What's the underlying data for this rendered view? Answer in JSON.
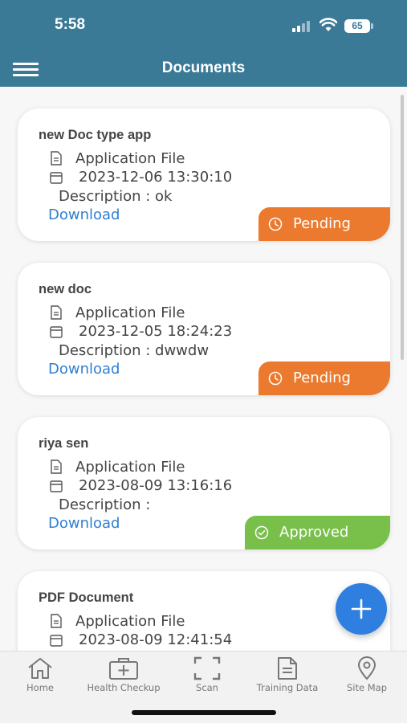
{
  "status_bar": {
    "time": "5:58",
    "battery": "65"
  },
  "header": {
    "title": "Documents",
    "menu_icon": "hamburger-menu-icon"
  },
  "documents": [
    {
      "title": "new Doc type app",
      "file_type": "Application File",
      "date": "2023-12-06 13:30:10",
      "description": "Description : ok",
      "download_label": "Download",
      "status": "Pending"
    },
    {
      "title": "new doc",
      "file_type": "Application File",
      "date": "2023-12-05 18:24:23",
      "description": "Description : dwwdw",
      "download_label": "Download",
      "status": "Pending"
    },
    {
      "title": "riya sen",
      "file_type": "Application File",
      "date": "2023-08-09 13:16:16",
      "description": "Description :",
      "download_label": "Download",
      "status": "Approved"
    },
    {
      "title": "PDF Document",
      "file_type": "Application File",
      "date": "2023-08-09 12:41:54"
    }
  ],
  "tabs": [
    {
      "label": "Home",
      "icon": "home-icon"
    },
    {
      "label": "Health Checkup",
      "icon": "medical-kit-icon"
    },
    {
      "label": "Scan",
      "icon": "scan-icon"
    },
    {
      "label": "Training Data",
      "icon": "document-icon"
    },
    {
      "label": "Site Map",
      "icon": "map-pin-icon"
    }
  ],
  "colors": {
    "header": "#3a7a97",
    "pending": "#eb7a2e",
    "approved": "#78c04a",
    "link": "#2f7fd1",
    "fab": "#2f7fe0"
  }
}
